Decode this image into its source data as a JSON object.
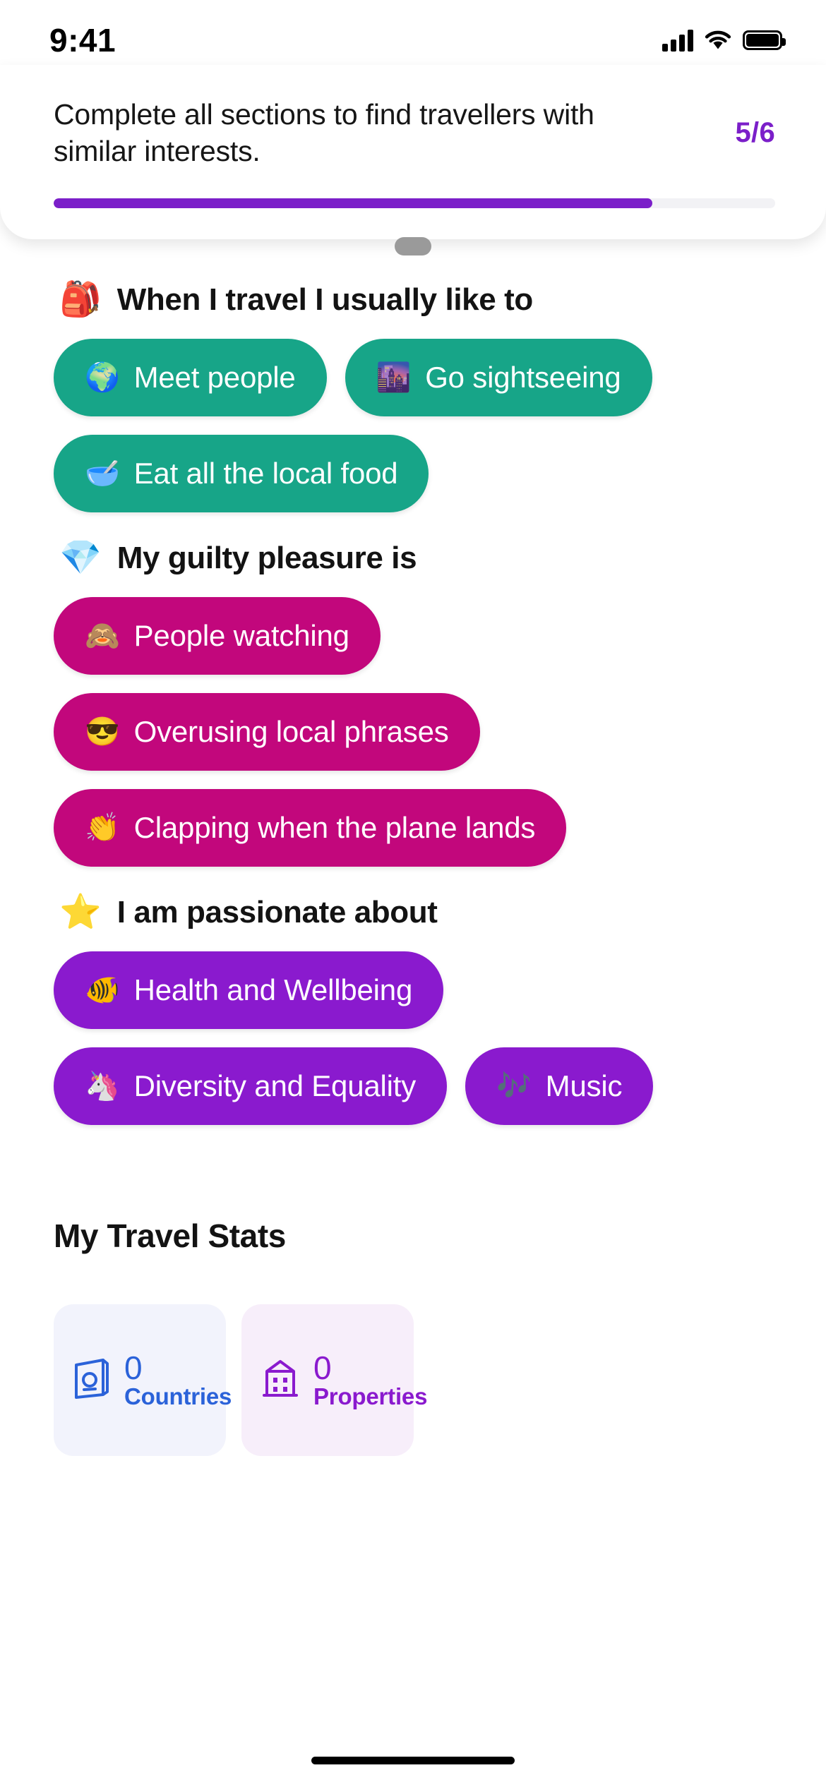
{
  "status_bar": {
    "time": "9:41",
    "signal_icon": "cellular-bars-icon",
    "wifi_icon": "wifi-icon",
    "battery_icon": "battery-full-icon"
  },
  "header": {
    "message": "Complete all sections to find travellers with similar interests.",
    "count": "5/6",
    "progress_percent": 83,
    "accent_color": "#7B1FC9",
    "track_color": "#F2F2F5"
  },
  "drag_handle": {
    "name": "sheet-drag-handle"
  },
  "sections": [
    {
      "emoji": "🎒",
      "emoji_name": "backpack-emoji",
      "title": "When I travel I usually like to",
      "chip_color": "#17A588",
      "chip_style": "teal",
      "rows": [
        [
          {
            "emoji": "🌍",
            "emoji_name": "globe-europe-africa-emoji",
            "label": "Meet people"
          },
          {
            "emoji": "🌆",
            "emoji_name": "cityscape-at-dusk-emoji",
            "label": "Go sightseeing"
          }
        ],
        [
          {
            "emoji": "🥣",
            "emoji_name": "bowl-with-spoon-emoji",
            "label": "Eat all the local food"
          }
        ]
      ]
    },
    {
      "emoji": "💎",
      "emoji_name": "gem-stone-emoji",
      "title": "My guilty pleasure is",
      "chip_color": "#C2077C",
      "chip_style": "pink",
      "rows": [
        [
          {
            "emoji": "🙈",
            "emoji_name": "see-no-evil-monkey-emoji",
            "label": "People watching"
          }
        ],
        [
          {
            "emoji": "😎",
            "emoji_name": "smiling-face-with-sunglasses-emoji",
            "label": "Overusing local phrases"
          }
        ],
        [
          {
            "emoji": "👏",
            "emoji_name": "clapping-hands-emoji",
            "label": "Clapping when the plane lands"
          }
        ]
      ]
    },
    {
      "emoji": "⭐",
      "emoji_name": "star-emoji",
      "title": "I am passionate about",
      "chip_color": "#8A1ACE",
      "chip_style": "purple",
      "rows": [
        [
          {
            "emoji": "🐠",
            "emoji_name": "tropical-fish-emoji",
            "label": "Health and Wellbeing"
          }
        ],
        [
          {
            "emoji": "🦄",
            "emoji_name": "unicorn-emoji",
            "label": "Diversity and Equality"
          },
          {
            "emoji": "🎶",
            "emoji_name": "musical-notes-emoji",
            "label": "Music"
          }
        ]
      ]
    }
  ],
  "travel_stats": {
    "title": "My Travel Stats",
    "cards": [
      {
        "icon_name": "passport-icon",
        "value": "0",
        "label": "Countries",
        "accent_color": "#2B62D9",
        "background_color": "#F2F3FC"
      },
      {
        "icon_name": "property-building-icon",
        "value": "0",
        "label": "Properties",
        "accent_color": "#8A1ACE",
        "background_color": "#F7EEFA"
      }
    ]
  },
  "home_indicator": {
    "name": "home-indicator"
  }
}
